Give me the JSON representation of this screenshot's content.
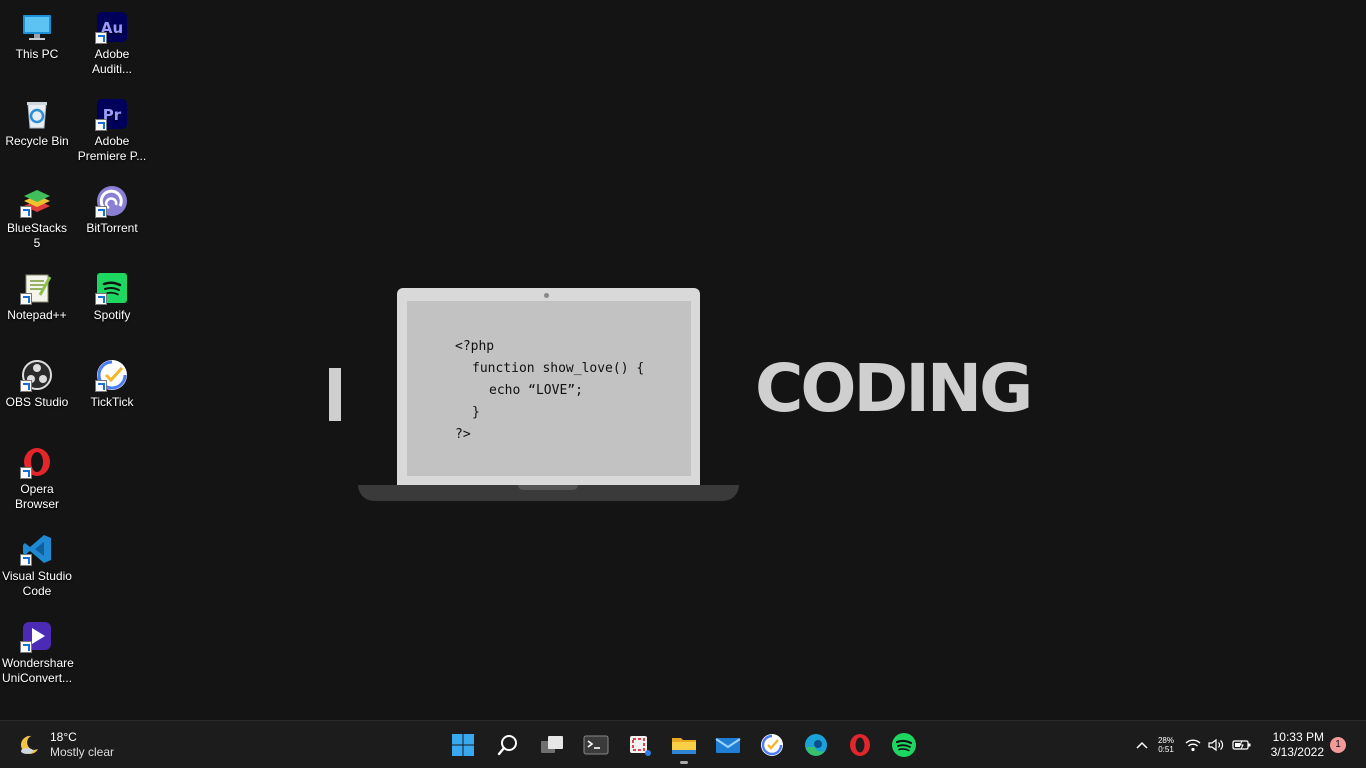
{
  "desktop": {
    "icons": [
      {
        "label": "This PC",
        "icon": "monitor-icon"
      },
      {
        "label": "Recycle Bin",
        "icon": "recycle-bin-icon"
      },
      {
        "label": "BlueStacks 5",
        "icon": "bluestacks-icon"
      },
      {
        "label": "Notepad++",
        "icon": "notepad-plus-plus-icon"
      },
      {
        "label": "OBS Studio",
        "icon": "obs-studio-icon"
      },
      {
        "label": "Opera Browser",
        "icon": "opera-icon"
      },
      {
        "label": "Visual Studio Code",
        "icon": "vscode-icon"
      },
      {
        "label": "Wondershare UniConvert...",
        "icon": "uniconverter-icon"
      },
      {
        "label": "Adobe Auditi...",
        "icon": "adobe-audition-icon",
        "glyph": "Au"
      },
      {
        "label": "Adobe Premiere P...",
        "icon": "adobe-premiere-icon",
        "glyph": "Pr"
      },
      {
        "label": "BitTorrent",
        "icon": "bittorrent-icon"
      },
      {
        "label": "Spotify",
        "icon": "spotify-icon"
      },
      {
        "label": "TickTick",
        "icon": "ticktick-icon"
      }
    ]
  },
  "wallpaper": {
    "left_word": "I",
    "right_word": "CODING",
    "code_lines": [
      "<?php",
      "function show_love() {",
      "echo “LOVE”;",
      "}",
      "?>"
    ]
  },
  "taskbar": {
    "weather": {
      "temp": "18°C",
      "condition": "Mostly clear"
    },
    "apps": [
      {
        "name": "start",
        "icon": "windows-start-icon"
      },
      {
        "name": "search",
        "icon": "search-icon"
      },
      {
        "name": "task-view",
        "icon": "task-view-icon"
      },
      {
        "name": "terminal",
        "icon": "terminal-icon"
      },
      {
        "name": "snipping-tool",
        "icon": "snipping-tool-icon"
      },
      {
        "name": "file-explorer",
        "icon": "folder-icon",
        "running": true
      },
      {
        "name": "mail",
        "icon": "mail-icon"
      },
      {
        "name": "ticktick",
        "icon": "ticktick-icon"
      },
      {
        "name": "edge",
        "icon": "edge-icon"
      },
      {
        "name": "opera",
        "icon": "opera-icon"
      },
      {
        "name": "spotify",
        "icon": "spotify-icon"
      }
    ],
    "tray": {
      "net_up": "28%",
      "net_down": "0:51",
      "time": "10:33 PM",
      "date": "3/13/2022",
      "notifications": "1"
    }
  }
}
